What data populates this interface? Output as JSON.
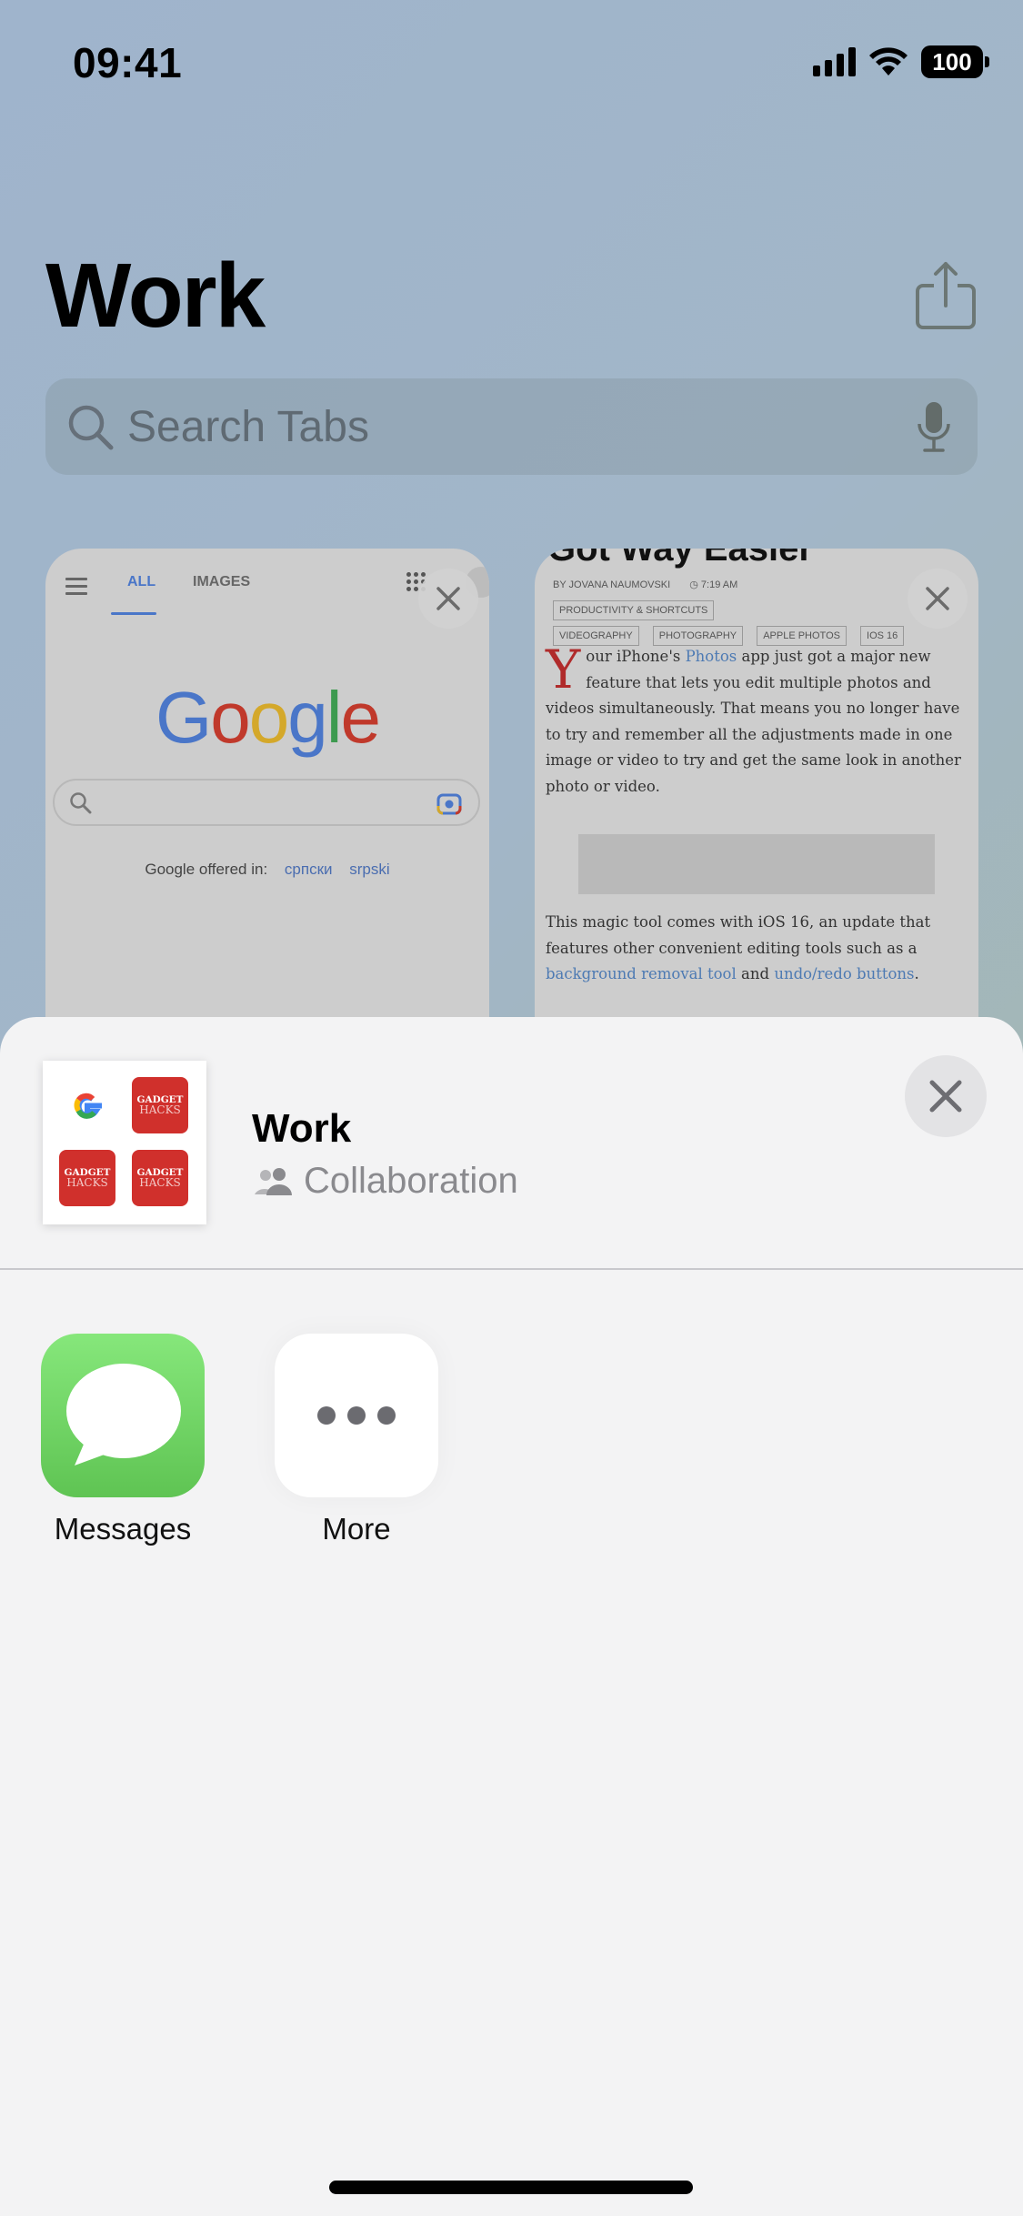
{
  "status_bar": {
    "time": "09:41",
    "battery": "100",
    "icons": [
      "cellular-signal-icon",
      "wifi-icon",
      "battery-icon"
    ]
  },
  "header": {
    "title": "Work",
    "share_icon": "share-icon"
  },
  "search": {
    "placeholder": "Search Tabs",
    "value": "",
    "icon": "search-icon",
    "mic_icon": "microphone-icon"
  },
  "tabs": [
    {
      "type": "google",
      "nav_tabs": [
        "ALL",
        "IMAGES"
      ],
      "active_nav_tab": "ALL",
      "logo": [
        "G",
        "o",
        "o",
        "g",
        "l",
        "e"
      ],
      "logo_colors": [
        "#4a76c8",
        "#c0392b",
        "#d4a82a",
        "#4a76c8",
        "#3d9a4f",
        "#c0392b"
      ],
      "offered_in_label": "Google offered in:",
      "languages": [
        "српски",
        "srpski"
      ]
    },
    {
      "type": "article",
      "headline_fragment": "Got Way Easier",
      "byline": "BY JOVANA NAUMOVSKI",
      "time": "7:19 AM",
      "tags": [
        "PRODUCTIVITY & SHORTCUTS",
        "VIDEOGRAPHY",
        "PHOTOGRAPHY",
        "APPLE PHOTOS",
        "IOS 16"
      ],
      "para1": {
        "drop_cap": "Y",
        "before_link": "our iPhone's ",
        "link": "Photos",
        "after_link": " app just got a major new feature that lets you edit multiple photos and videos simultaneously. That means you no longer have to try and remember all the adjustments made in one image or video to try and get the same look in another photo or video."
      },
      "para2": {
        "text": "This magic tool comes with iOS 16, an update that features other convenient editing tools such as a ",
        "link1": "background removal tool",
        "mid": " and ",
        "link2": "undo/redo buttons",
        "end": "."
      }
    }
  ],
  "share_sheet": {
    "title": "Work",
    "subtitle": "Collaboration",
    "subtitle_icon": "people-icon",
    "thumbnail": {
      "cells": [
        "google",
        "gadget-hacks",
        "gadget-hacks",
        "gadget-hacks"
      ],
      "gadget_hacks_line1": "GADGET",
      "gadget_hacks_line2": "HACKS"
    },
    "apps": [
      {
        "label": "Messages",
        "icon": "messages-icon"
      },
      {
        "label": "More",
        "icon": "more-icon"
      }
    ]
  },
  "colors": {
    "accent_link": "#4d7ab3",
    "messages_green": "#6fd464",
    "gadget_red": "#d0302c"
  }
}
